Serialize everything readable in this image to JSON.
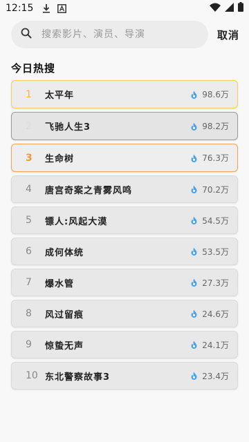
{
  "statusbar": {
    "time": "12:15"
  },
  "search": {
    "placeholder": "搜索影片、演员、导演",
    "cancel_label": "取消"
  },
  "section": {
    "title": "今日热搜"
  },
  "colors": {
    "rank1": "#f3b64b",
    "rank3": "#f09b33",
    "heat_icon": "#4aa3e6"
  },
  "hot_list": [
    {
      "rank": "1",
      "title": "太平年",
      "heat": "98.6万"
    },
    {
      "rank": "2",
      "title": "飞驰人生3",
      "heat": "98.2万"
    },
    {
      "rank": "3",
      "title": "生命树",
      "heat": "76.3万"
    },
    {
      "rank": "4",
      "title": "唐宫奇案之青雾风鸣",
      "heat": "70.2万"
    },
    {
      "rank": "5",
      "title": "镖人:风起大漠",
      "heat": "54.5万"
    },
    {
      "rank": "6",
      "title": "成何体统",
      "heat": "53.5万"
    },
    {
      "rank": "7",
      "title": "爆水管",
      "heat": "27.3万"
    },
    {
      "rank": "8",
      "title": "风过留痕",
      "heat": "24.6万"
    },
    {
      "rank": "9",
      "title": "惊蛰无声",
      "heat": "24.1万"
    },
    {
      "rank": "10",
      "title": "东北警察故事3",
      "heat": "23.4万"
    }
  ]
}
